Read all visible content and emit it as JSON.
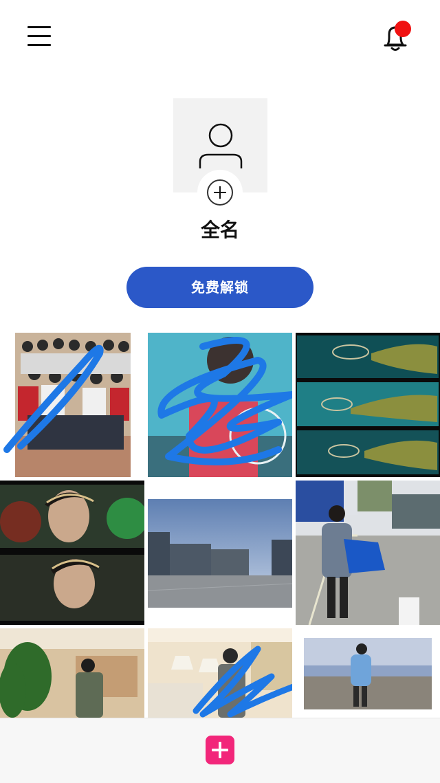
{
  "header": {
    "menu_icon": "hamburger-menu-icon",
    "bell_icon": "bell-icon",
    "has_unread_notification": true
  },
  "profile": {
    "avatar_icon": "person-placeholder-icon",
    "add_avatar_icon": "plus-circle-icon",
    "name": "全名"
  },
  "unlock_button": {
    "label": "免费解锁"
  },
  "colors": {
    "accent_blue": "#2b58c8",
    "notification_red": "#f01212",
    "add_button_pink": "#f2267a"
  },
  "photos": [
    {
      "id": "group-photo",
      "scribbled": true
    },
    {
      "id": "selfie-portrait",
      "scribbled": true
    },
    {
      "id": "movie-still-triptych",
      "scribbled": false
    },
    {
      "id": "movie-still-pair",
      "scribbled": false
    },
    {
      "id": "building-plaza",
      "scribbled": false
    },
    {
      "id": "person-with-blue-bag",
      "scribbled": false
    },
    {
      "id": "store-interior-plants",
      "scribbled": false
    },
    {
      "id": "store-interior-lamps",
      "scribbled": true
    },
    {
      "id": "person-at-shore",
      "scribbled": false
    }
  ],
  "bottom_bar": {
    "add_icon": "plus-square-icon"
  }
}
